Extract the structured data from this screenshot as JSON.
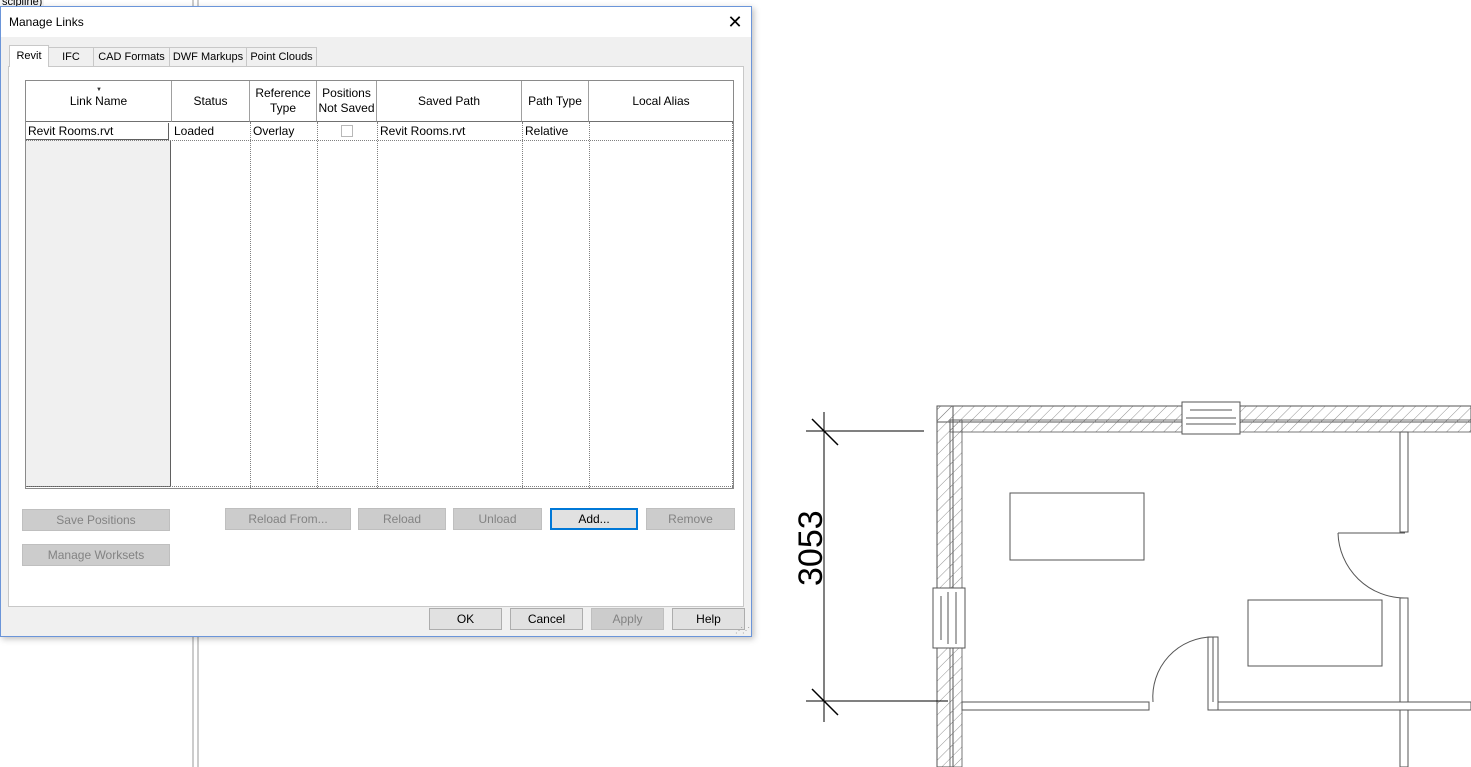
{
  "background": {
    "partial_text": "scipline)",
    "dimension_label": "3053"
  },
  "dialog": {
    "title": "Manage Links",
    "close_icon": "close-icon",
    "tabs": [
      {
        "label": "Revit",
        "active": true
      },
      {
        "label": "IFC",
        "active": false
      },
      {
        "label": "CAD Formats",
        "active": false
      },
      {
        "label": "DWF Markups",
        "active": false
      },
      {
        "label": "Point Clouds",
        "active": false
      }
    ],
    "table": {
      "sort_icon": "sort-down-icon",
      "columns": [
        "Link Name",
        "Status",
        "Reference Type",
        "Positions Not Saved",
        "Saved Path",
        "Path Type",
        "Local Alias"
      ],
      "rows": [
        {
          "link_name": "Revit Rooms.rvt",
          "status": "Loaded",
          "reference_type": "Overlay",
          "positions_not_saved": false,
          "saved_path": "Revit Rooms.rvt",
          "path_type": "Relative",
          "local_alias": ""
        }
      ]
    },
    "buttons": {
      "save_positions": "Save Positions",
      "manage_worksets": "Manage Worksets",
      "reload_from": "Reload From...",
      "reload": "Reload",
      "unload": "Unload",
      "add": "Add...",
      "remove": "Remove",
      "ok": "OK",
      "cancel": "Cancel",
      "apply": "Apply",
      "help": "Help"
    }
  }
}
